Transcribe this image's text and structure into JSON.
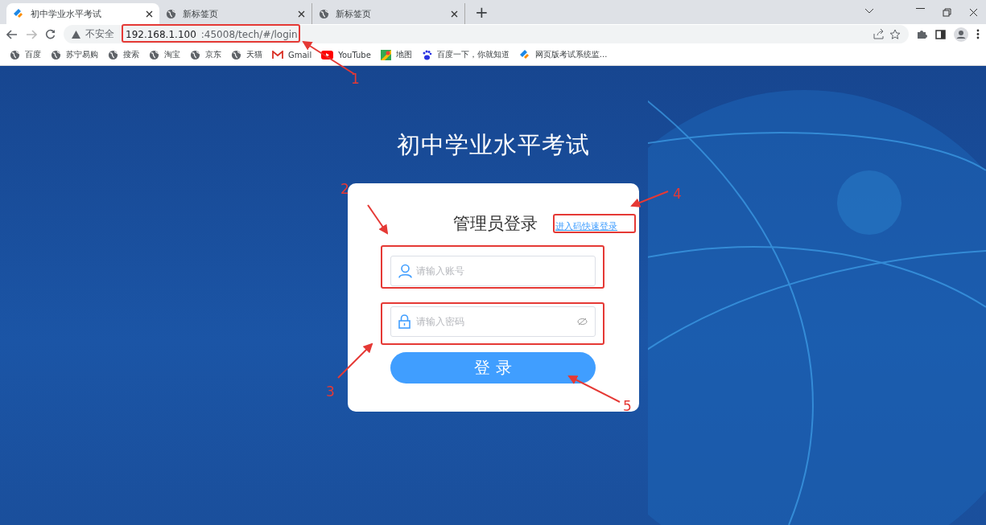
{
  "browser": {
    "tabs": [
      {
        "title": "初中学业水平考试",
        "kind": "app",
        "selected": true
      },
      {
        "title": "新标签页",
        "kind": "globe",
        "selected": false
      },
      {
        "title": "新标签页",
        "kind": "globe",
        "selected": false
      }
    ],
    "new_tab": "+",
    "address_bar": {
      "security": "不安全",
      "host": "192.168.1.100",
      "path": ":45008/tech/#/login"
    },
    "bookmarks": [
      {
        "label": "百度",
        "kind": "globe"
      },
      {
        "label": "苏宁易购",
        "kind": "globe"
      },
      {
        "label": "搜索",
        "kind": "globe"
      },
      {
        "label": "淘宝",
        "kind": "globe"
      },
      {
        "label": "京东",
        "kind": "globe"
      },
      {
        "label": "天猫",
        "kind": "globe"
      },
      {
        "label": "Gmail",
        "kind": "gmail"
      },
      {
        "label": "YouTube",
        "kind": "youtube"
      },
      {
        "label": "地图",
        "kind": "maps"
      },
      {
        "label": "百度一下，你就知道",
        "kind": "paw"
      },
      {
        "label": "网页版考试系统监...",
        "kind": "app"
      }
    ]
  },
  "page": {
    "title": "初中学业水平考试",
    "login": {
      "heading": "管理员登录",
      "quick_link": "进入码快速登录",
      "fields": [
        {
          "kind": "account",
          "placeholder": "请输入账号"
        },
        {
          "kind": "password",
          "placeholder": "请输入密码"
        }
      ],
      "submit": "登 录"
    }
  },
  "annotations": [
    {
      "label": "1"
    },
    {
      "label": "2"
    },
    {
      "label": "3"
    },
    {
      "label": "4"
    },
    {
      "label": "5"
    }
  ]
}
